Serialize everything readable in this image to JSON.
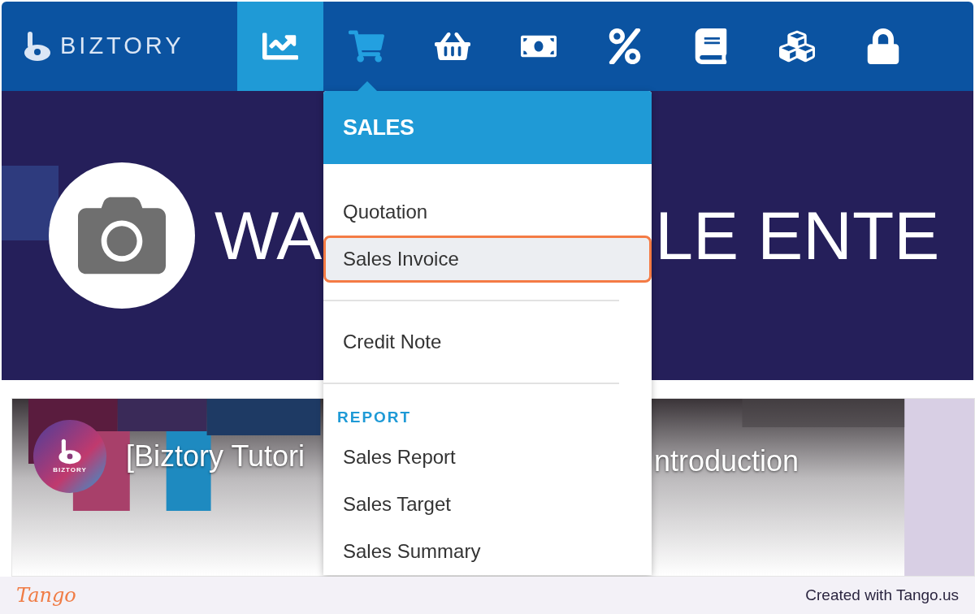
{
  "brand": {
    "name": "BIZTORY"
  },
  "nav": [
    {
      "kind": "chart",
      "selected": true,
      "open": false
    },
    {
      "kind": "cart",
      "selected": false,
      "open": true
    },
    {
      "kind": "basket",
      "selected": false,
      "open": false
    },
    {
      "kind": "money",
      "selected": false,
      "open": false
    },
    {
      "kind": "percent",
      "selected": false,
      "open": false
    },
    {
      "kind": "book",
      "selected": false,
      "open": false
    },
    {
      "kind": "cubes",
      "selected": false,
      "open": false
    },
    {
      "kind": "lock",
      "selected": false,
      "open": false
    }
  ],
  "banner": {
    "title_left": "WA",
    "title_right": "LE ENTE"
  },
  "video": {
    "channel": "BIZTORY",
    "title_left": "[Biztory Tutori",
    "title_right": "ntroduction"
  },
  "menu": {
    "title": "SALES",
    "items": [
      {
        "kind": "item",
        "label": "Quotation",
        "selected": false
      },
      {
        "kind": "item",
        "label": "Sales Invoice",
        "selected": true
      },
      {
        "kind": "divider"
      },
      {
        "kind": "item",
        "label": "Credit Note",
        "selected": false
      },
      {
        "kind": "divider"
      },
      {
        "kind": "heading",
        "label": "REPORT"
      },
      {
        "kind": "item",
        "label": "Sales Report",
        "selected": false
      },
      {
        "kind": "item",
        "label": "Sales Target",
        "selected": false
      },
      {
        "kind": "item",
        "label": "Sales Summary",
        "selected": false
      }
    ]
  },
  "footer": {
    "logo": "Tango",
    "credit": "Created with Tango.us"
  }
}
